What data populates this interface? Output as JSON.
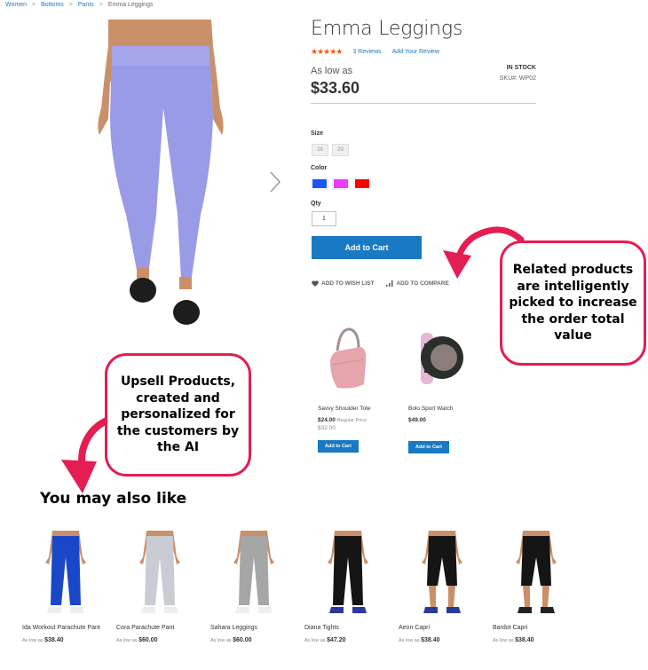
{
  "breadcrumb": [
    {
      "label": "Women",
      "link": true
    },
    {
      "label": "Bottoms",
      "link": true
    },
    {
      "label": "Pants",
      "link": true
    },
    {
      "label": "Emma Leggings",
      "link": false
    }
  ],
  "breadcrumb_sep": ">",
  "product": {
    "title": "Emma Leggings",
    "rating_stars": "★★★★★",
    "rating_value": 4.5,
    "reviews_label": "3  Reviews",
    "add_review_label": "Add Your Review",
    "price_label": "As low as",
    "price": "$33.60",
    "stock": "IN STOCK",
    "sku": "SKU#:  WP02",
    "image_color": "#9a9be6",
    "size_label": "Size",
    "sizes": [
      "28",
      "29"
    ],
    "color_label": "Color",
    "colors": [
      "#1c56f7",
      "#ee38f8",
      "#fe0000"
    ],
    "qty_label": "Qty",
    "qty": "1",
    "add_to_cart": "Add to Cart",
    "wishlist": "ADD TO WISH LIST",
    "compare": "ADD TO COMPARE"
  },
  "related": [
    {
      "name": "Savvy Shoulder Tote",
      "price": "$24.00",
      "regular_label": "Regular Price",
      "old_price": "$32.00",
      "button": "Add to Cart"
    },
    {
      "name": "Bolo Sport Watch",
      "price": "$49.00",
      "regular_label": "",
      "old_price": "",
      "button": "Add to Cart"
    }
  ],
  "callouts": {
    "related": "Related products are intelligently picked to increase the order total value",
    "upsell": "Upsell Products, created and personalized for the customers by the AI"
  },
  "accent_color": "#e41d53",
  "brand_blue": "#1979c3",
  "upsell": {
    "title": "You may also like",
    "price_prefix": "As low as",
    "items": [
      {
        "name": "Ida Workout Parachute Pant",
        "price": "$38.40",
        "color": "#1a47c8"
      },
      {
        "name": "Cora Parachute Pant",
        "price": "$60.00",
        "color": "#c9ccd2"
      },
      {
        "name": "Sahara Leggings",
        "price": "$60.00",
        "color": "#a6a6a6"
      },
      {
        "name": "Diana Tights",
        "price": "$47.20",
        "color": "#151515"
      },
      {
        "name": "Aeon Capri",
        "price": "$38.40",
        "color": "#151515"
      },
      {
        "name": "Bardot Capri",
        "price": "$38.40",
        "color": "#151515"
      }
    ]
  }
}
